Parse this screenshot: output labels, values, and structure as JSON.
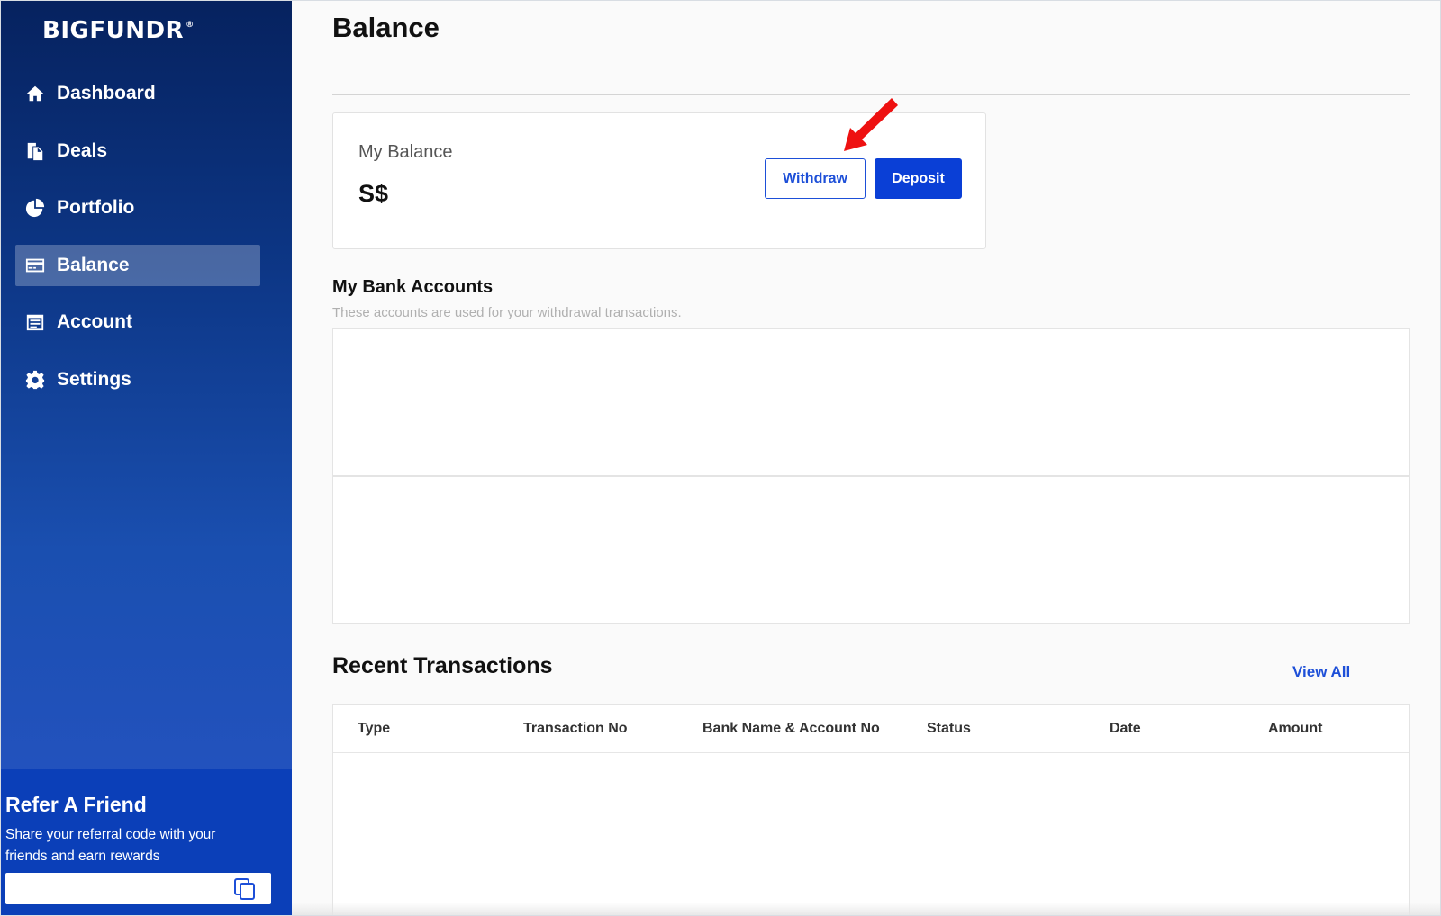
{
  "app": {
    "logo_text": "BIGFUNDR",
    "logo_mark": "®"
  },
  "sidebar": {
    "items": [
      {
        "label": "Dashboard",
        "icon": "home-icon"
      },
      {
        "label": "Deals",
        "icon": "documents-icon"
      },
      {
        "label": "Portfolio",
        "icon": "pie-chart-icon"
      },
      {
        "label": "Balance",
        "icon": "credit-card-icon",
        "active": true
      },
      {
        "label": "Account",
        "icon": "ledger-icon"
      },
      {
        "label": "Settings",
        "icon": "gear-icon"
      }
    ],
    "refer": {
      "title": "Refer A Friend",
      "text": "Share your referral code with your friends and earn rewards",
      "code_value": ""
    }
  },
  "main": {
    "title": "Balance",
    "balance": {
      "label": "My Balance",
      "value": "S$",
      "withdraw_label": "Withdraw",
      "deposit_label": "Deposit"
    },
    "bank_accounts": {
      "title": "My Bank Accounts",
      "subtitle": "These accounts are used for your withdrawal transactions."
    },
    "transactions": {
      "title": "Recent Transactions",
      "view_all_label": "View All",
      "columns": [
        "Type",
        "Transaction No",
        "Bank Name & Account No",
        "Status",
        "Date",
        "Amount"
      ]
    }
  },
  "colors": {
    "sidebar_top": "#06225f",
    "sidebar_bottom": "#2352be",
    "accent": "#0a3fd6",
    "annotation_arrow": "#ee1111"
  }
}
